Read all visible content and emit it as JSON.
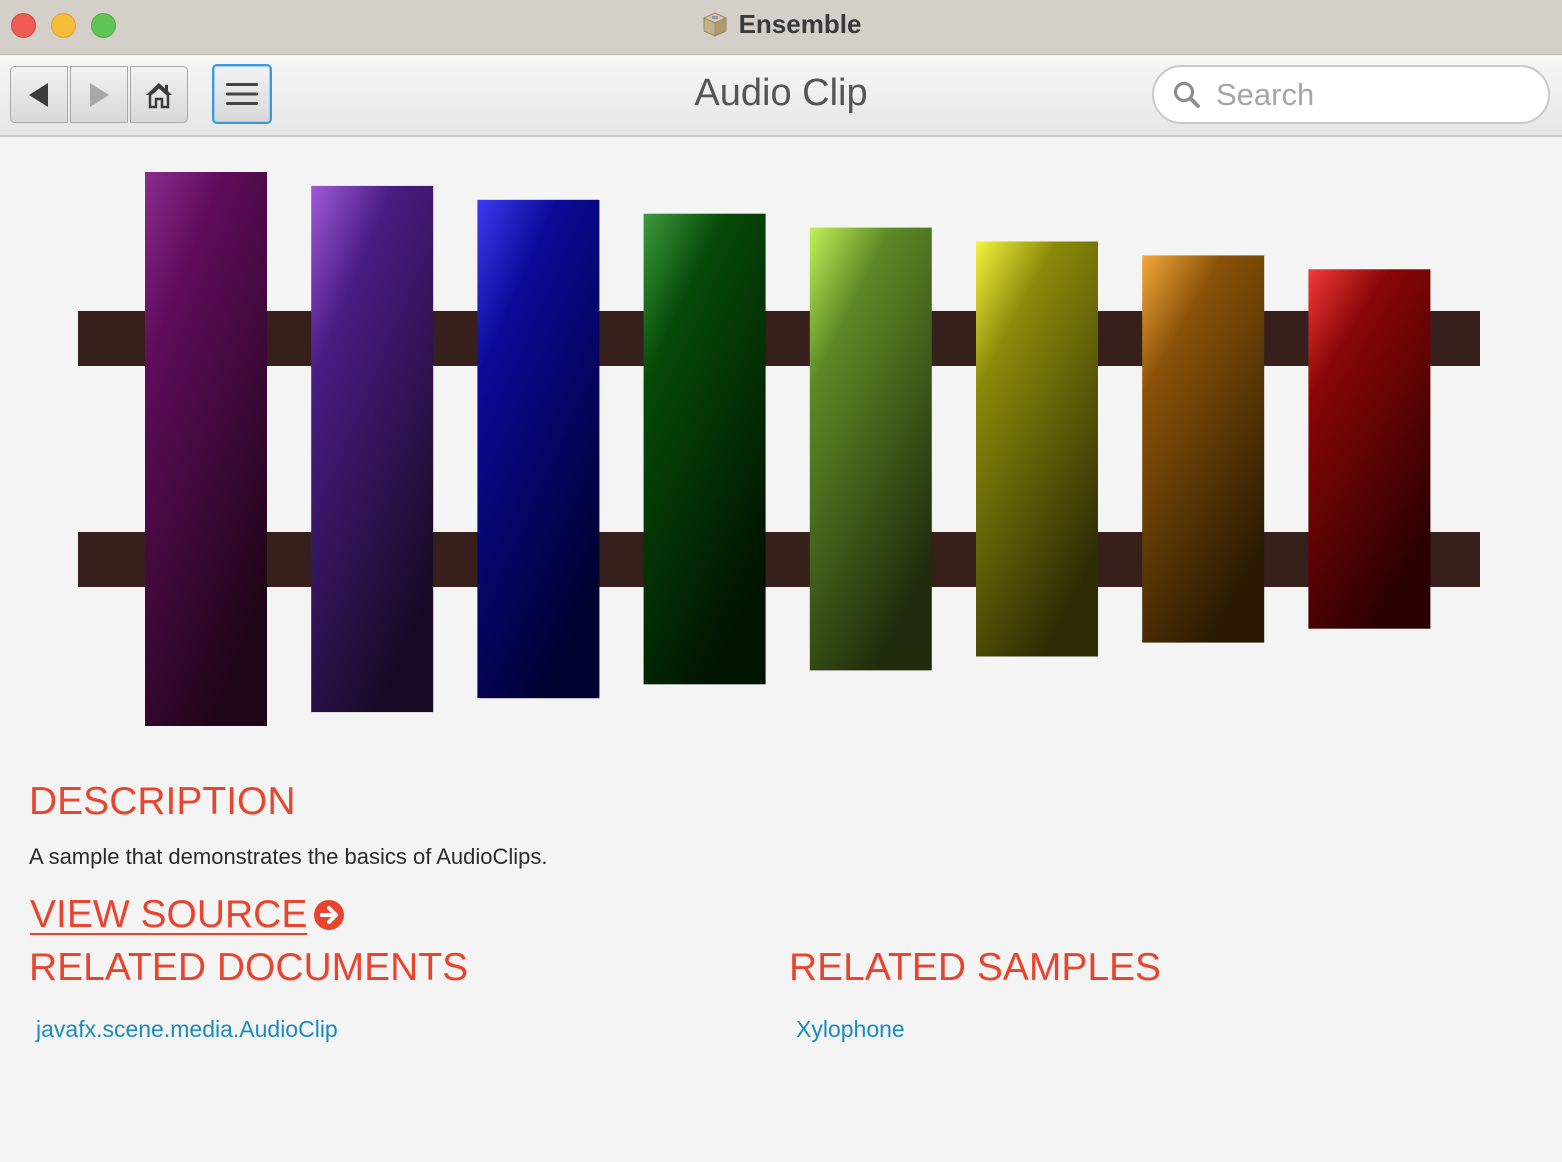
{
  "window": {
    "app_title": "Ensemble"
  },
  "toolbar": {
    "back_icon": "back-arrow-icon",
    "forward_icon": "forward-arrow-icon",
    "home_icon": "home-icon",
    "menu_icon": "hamburger-menu-icon",
    "page_title": "Audio Clip",
    "search_placeholder": "Search"
  },
  "xylophone": {
    "bar_colors": [
      [
        "#8b2a8e",
        "#5e0c5a",
        "#1f0518"
      ],
      [
        "#a05ad8",
        "#4a1c84",
        "#170a26"
      ],
      [
        "#3b3bf0",
        "#0a0a98",
        "#000030"
      ],
      [
        "#3c9a3c",
        "#064a08",
        "#001400"
      ],
      [
        "#c2f058",
        "#5c8a26",
        "#202c0c"
      ],
      [
        "#f4f23e",
        "#8a8a0a",
        "#2e2c04"
      ],
      [
        "#f4a83a",
        "#8a5208",
        "#2a1a02"
      ],
      [
        "#f23a3a",
        "#8a0606",
        "#2a0000"
      ]
    ],
    "rail_color": "#371f1c"
  },
  "description": {
    "heading": "DESCRIPTION",
    "text": "A sample that demonstrates the basics of AudioClips."
  },
  "view_source": {
    "label": "VIEW SOURCE",
    "icon": "circle-arrow-right-icon"
  },
  "related_documents": {
    "heading": "RELATED DOCUMENTS",
    "items": [
      "javafx.scene.media.AudioClip"
    ]
  },
  "related_samples": {
    "heading": "RELATED SAMPLES",
    "items": [
      "Xylophone"
    ]
  },
  "colors": {
    "accent": "#e8452e",
    "link": "#1a8bc0",
    "focus": "#3a9ad9"
  }
}
